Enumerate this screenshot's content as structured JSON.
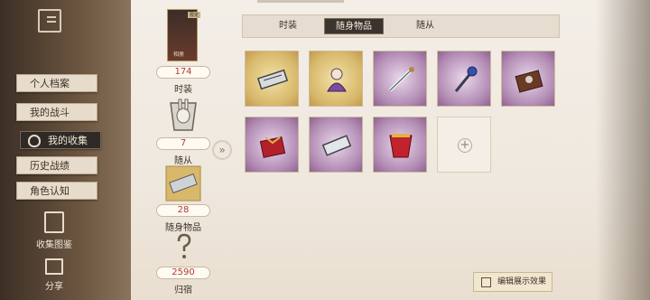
{
  "sidebar": {
    "items": [
      {
        "label": "个人档案"
      },
      {
        "label": "我的战斗"
      },
      {
        "label": "我的收集"
      },
      {
        "label": "历史战绩"
      },
      {
        "label": "角色认知"
      }
    ],
    "tools": [
      {
        "label": "收集图鉴",
        "icon": "book-icon"
      },
      {
        "label": "分享",
        "icon": "share-icon"
      }
    ]
  },
  "stats": {
    "portrait_name": "相册",
    "portrait_tag": "限定",
    "outfits": {
      "count": "174",
      "label": "时装"
    },
    "pets": {
      "count": "7",
      "label": "随从"
    },
    "accessories": {
      "count": "28",
      "label": "随身物品"
    },
    "homes": {
      "count": "2590",
      "label": "归宿"
    }
  },
  "tabs": [
    {
      "label": "时装"
    },
    {
      "label": "随身物品"
    },
    {
      "label": "随从"
    }
  ],
  "grid": {
    "items": [
      {
        "icon": "harmonica-icon",
        "frame": "gold"
      },
      {
        "icon": "doll-icon",
        "frame": "gold"
      },
      {
        "icon": "cane-icon",
        "frame": "purple"
      },
      {
        "icon": "blue-rose-cane-icon",
        "frame": "purple"
      },
      {
        "icon": "music-box-icon",
        "frame": "purple"
      },
      {
        "icon": "red-gift-icon",
        "frame": "purple"
      },
      {
        "icon": "silver-harmonica-icon",
        "frame": "purple"
      },
      {
        "icon": "red-cape-icon",
        "frame": "purple"
      }
    ],
    "add_icon": "plus-icon"
  },
  "edit_button": {
    "label": "编辑展示效果"
  },
  "colors": {
    "accent_red": "#b23a2e",
    "dark_tab": "#3b342e",
    "paper": "#f3eee7"
  }
}
